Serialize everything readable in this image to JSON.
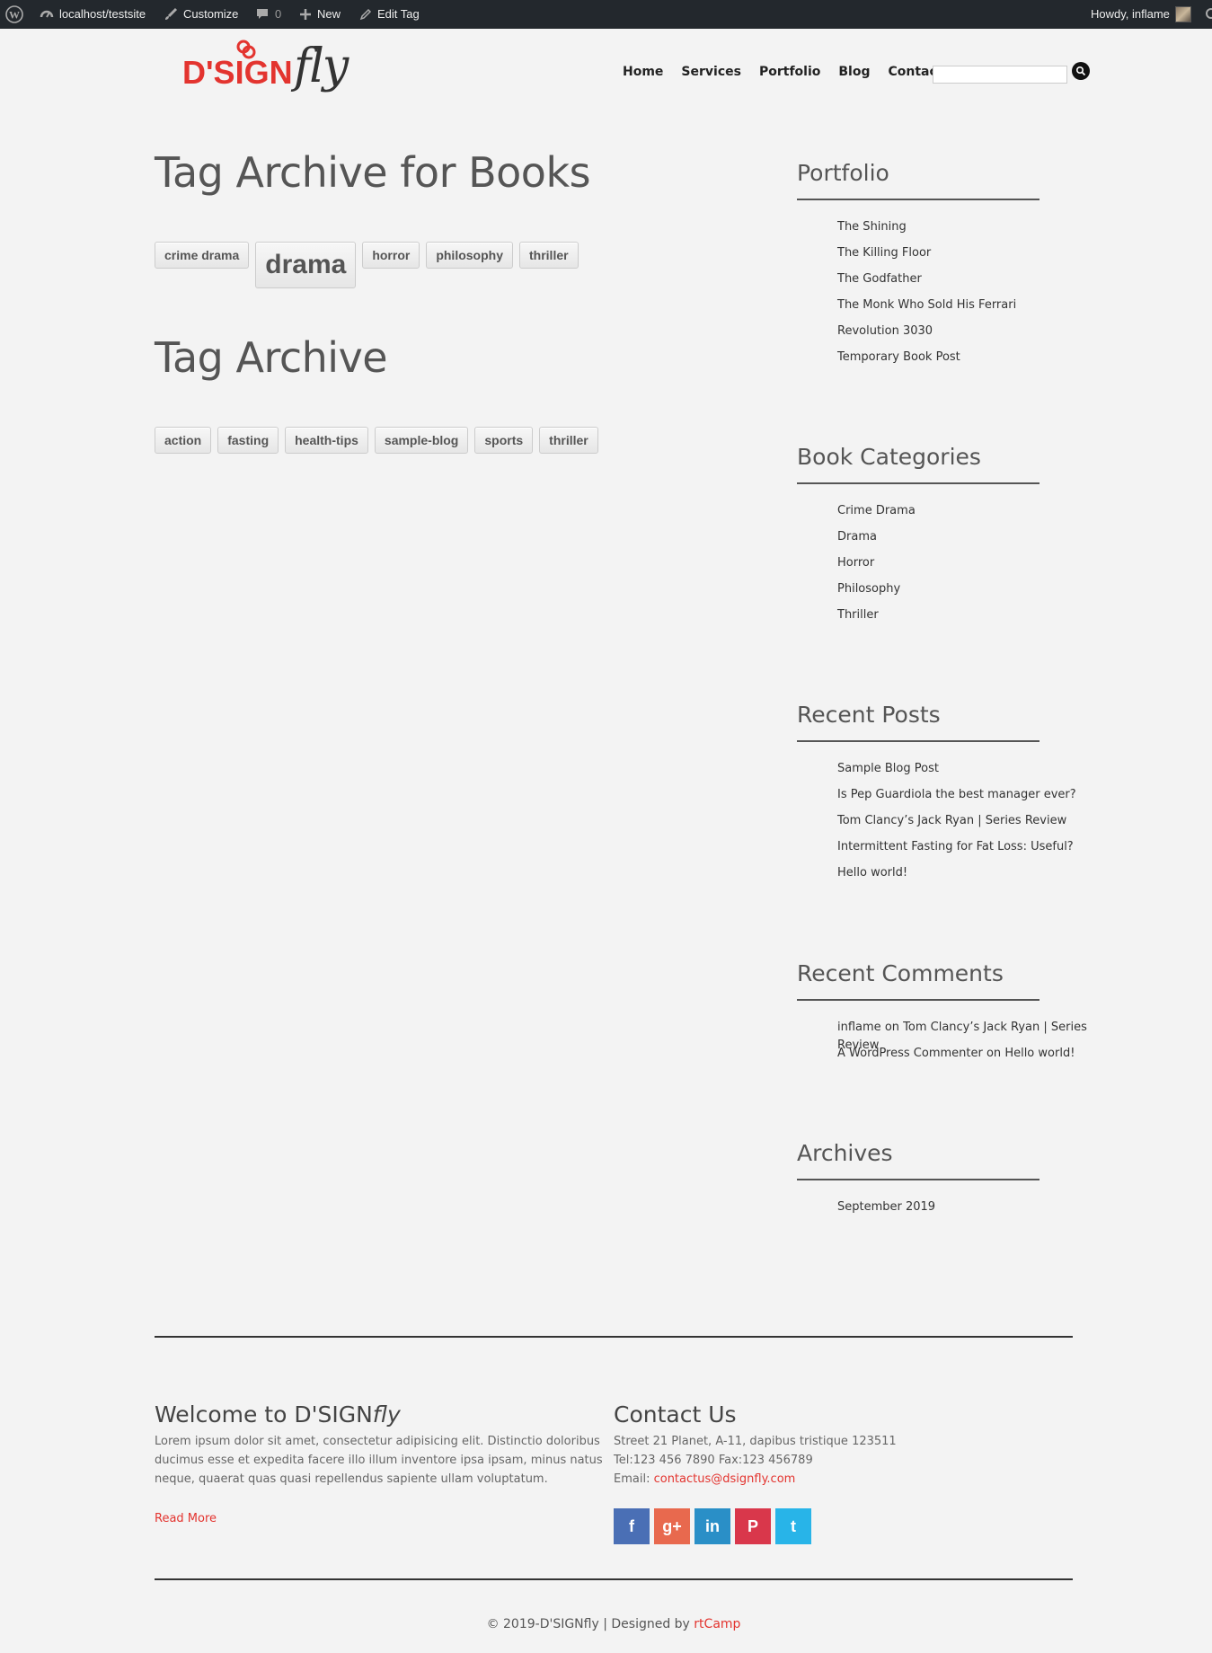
{
  "admin_bar": {
    "site": "localhost/testsite",
    "customize": "Customize",
    "comments_count": "0",
    "new": "New",
    "edit": "Edit Tag",
    "howdy": "Howdy, inflame"
  },
  "brand": {
    "logo_main": "D'SIGN",
    "logo_script": "fly",
    "accent_color": "#e3342f"
  },
  "nav": {
    "items": [
      "Home",
      "Services",
      "Portfolio",
      "Blog",
      "Contact"
    ]
  },
  "search": {
    "placeholder": ""
  },
  "main": {
    "title_books": "Tag Archive for Books",
    "books_tags": [
      "crime drama",
      "drama",
      "horror",
      "philosophy",
      "thriller"
    ],
    "title_tags": "Tag Archive",
    "tags": [
      "action",
      "fasting",
      "health-tips",
      "sample-blog",
      "sports",
      "thriller"
    ]
  },
  "sidebar": {
    "portfolio": {
      "title": "Portfolio",
      "items": [
        "The Shining",
        "The Killing Floor",
        "The Godfather",
        "The Monk Who Sold His Ferrari",
        "Revolution 3030",
        "Temporary Book Post"
      ]
    },
    "book_categories": {
      "title": "Book Categories",
      "items": [
        "Crime Drama",
        "Drama",
        "Horror",
        "Philosophy",
        "Thriller"
      ]
    },
    "recent_posts": {
      "title": "Recent Posts",
      "items": [
        "Sample Blog Post",
        "Is Pep Guardiola the best manager ever?",
        "Tom Clancy’s Jack Ryan | Series Review",
        "Intermittent Fasting for Fat Loss: Useful?",
        "Hello world!"
      ]
    },
    "recent_comments": {
      "title": "Recent Comments",
      "items": [
        {
          "author": "inflame",
          "on": "on",
          "post": "Tom Clancy’s Jack Ryan | Series Review"
        },
        {
          "author": "A WordPress Commenter",
          "on": "on",
          "post": "Hello world!"
        }
      ]
    },
    "archives": {
      "title": "Archives",
      "items": [
        "September 2019"
      ]
    }
  },
  "footer": {
    "welcome_title": "Welcome to D'SIGN",
    "welcome_title_script": "fly",
    "welcome_text": "Lorem ipsum dolor sit amet, consectetur adipisicing elit. Distinctio doloribus ducimus esse et expedita facere illo illum inventore ipsa ipsam, minus natus neque, quaerat quas quasi repellendus sapiente ullam voluptatum.",
    "read_more": "Read More",
    "contact_title": "Contact Us",
    "address": "Street 21 Planet, A-11, dapibus tristique 123511",
    "phone": "Tel:123 456 7890 Fax:123 456789",
    "email_label": "Email: ",
    "email": "contactus@dsignfly.com",
    "social": [
      {
        "name": "facebook",
        "glyph": "f",
        "color": "#4a6fb5"
      },
      {
        "name": "google-plus",
        "glyph": "g+",
        "color": "#e8694e"
      },
      {
        "name": "linkedin",
        "glyph": "in",
        "color": "#2a8fc7"
      },
      {
        "name": "pinterest",
        "glyph": "P",
        "color": "#d9374b"
      },
      {
        "name": "twitter",
        "glyph": "t",
        "color": "#28b4e8"
      }
    ],
    "copyright": "© 2019-D'SIGNfly | Designed by ",
    "designer": "rtCamp"
  }
}
